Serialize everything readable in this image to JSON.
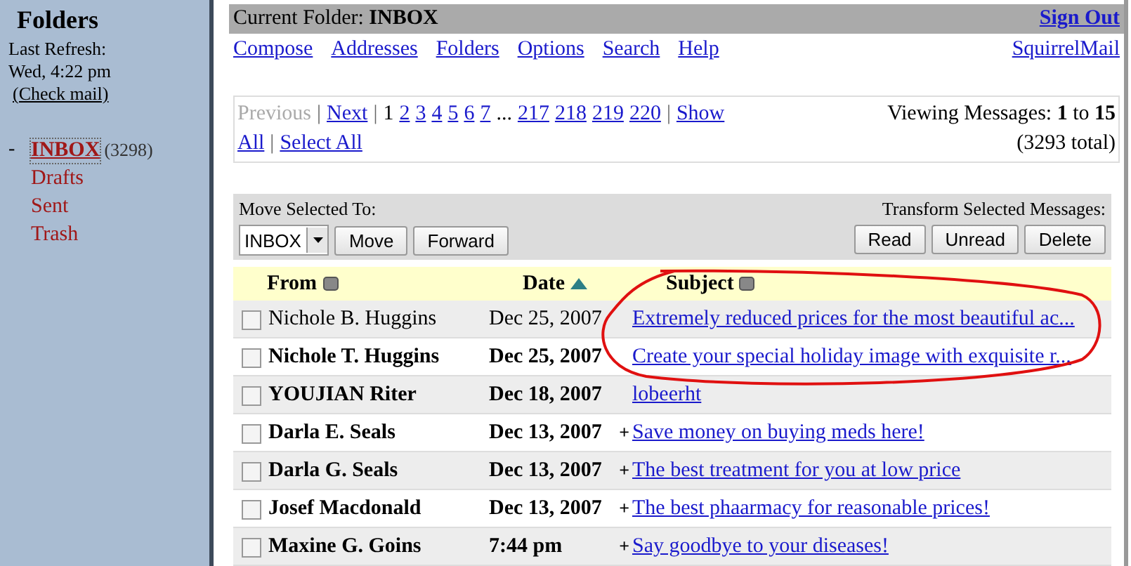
{
  "sidebar": {
    "title": "Folders",
    "refresh_label": "Last Refresh:",
    "refresh_time": "Wed, 4:22 pm",
    "check_mail": "(Check mail)",
    "tree_marker": "-",
    "folders": [
      {
        "name": "INBOX",
        "count": "(3298)",
        "selected": true
      },
      {
        "name": "Drafts",
        "selected": false
      },
      {
        "name": "Sent",
        "selected": false
      },
      {
        "name": "Trash",
        "selected": false
      }
    ]
  },
  "header": {
    "label": "Current Folder:",
    "folder": "INBOX",
    "sign_out": "Sign Out"
  },
  "nav": {
    "links": [
      "Compose",
      "Addresses",
      "Folders",
      "Options",
      "Search",
      "Help"
    ],
    "brand": "SquirrelMail"
  },
  "pager": {
    "items": [
      {
        "text": "Previous",
        "kind": "disabled"
      },
      {
        "text": "|",
        "kind": "sep"
      },
      {
        "text": "Next",
        "kind": "link"
      },
      {
        "text": "|",
        "kind": "sep"
      },
      {
        "text": "1",
        "kind": "current"
      },
      {
        "text": "2",
        "kind": "link"
      },
      {
        "text": "3",
        "kind": "link"
      },
      {
        "text": "4",
        "kind": "link"
      },
      {
        "text": "5",
        "kind": "link"
      },
      {
        "text": "6",
        "kind": "link"
      },
      {
        "text": "7",
        "kind": "link"
      },
      {
        "text": "...",
        "kind": "plain"
      },
      {
        "text": "217",
        "kind": "link"
      },
      {
        "text": "218",
        "kind": "link"
      },
      {
        "text": "219",
        "kind": "link"
      },
      {
        "text": "220",
        "kind": "link"
      },
      {
        "text": "|",
        "kind": "sep"
      },
      {
        "text": "Show",
        "kind": "link"
      }
    ],
    "second_line": [
      {
        "text": "All",
        "kind": "link"
      },
      {
        "text": "|",
        "kind": "sep"
      },
      {
        "text": "Select All",
        "kind": "link"
      }
    ],
    "viewing": "Viewing Messages: **1** to **15**",
    "total": "(3293 total)"
  },
  "actions": {
    "move_label": "Move Selected To:",
    "folder_select": "INBOX",
    "move_buttons": [
      "Move",
      "Forward"
    ],
    "transform_label": "Transform Selected Messages:",
    "transform_buttons": [
      "Read",
      "Unread",
      "Delete"
    ]
  },
  "table": {
    "columns": [
      {
        "label": "From",
        "kind": "unsorted"
      },
      {
        "label": "Date",
        "kind": "ascending"
      },
      {
        "label": "Subject",
        "kind": "unsorted"
      }
    ],
    "rows": [
      {
        "from": "Nichole B. Huggins",
        "date": "Dec 25, 2007",
        "subject": "Extremely reduced prices for the most beautiful ac...",
        "unread": false,
        "checked": false
      },
      {
        "from": "Nichole T. Huggins",
        "date": "Dec 25, 2007",
        "subject": "Create your special holiday image with exquisite r...",
        "unread": true,
        "checked": false
      },
      {
        "from": "YOUJIAN Riter",
        "date": "Dec 18, 2007",
        "subject": "lobeerht",
        "unread": true,
        "checked": false
      },
      {
        "from": "Darla E. Seals",
        "date": "Dec 13, 2007",
        "flag": "+",
        "subject": "Save money on buying meds here!",
        "unread": true,
        "checked": false
      },
      {
        "from": "Darla G. Seals",
        "date": "Dec 13, 2007",
        "flag": "+",
        "subject": "The best treatment for you at low price",
        "unread": true,
        "checked": false
      },
      {
        "from": "Josef Macdonald",
        "date": "Dec 13, 2007",
        "flag": "+",
        "subject": "The best phaarmacy for reasonable prices!",
        "unread": true,
        "checked": false
      },
      {
        "from": "Maxine G. Goins",
        "date": "7:44 pm",
        "flag": "+",
        "subject": "Say goodbye to your diseases!",
        "unread": true,
        "checked": false
      }
    ]
  }
}
